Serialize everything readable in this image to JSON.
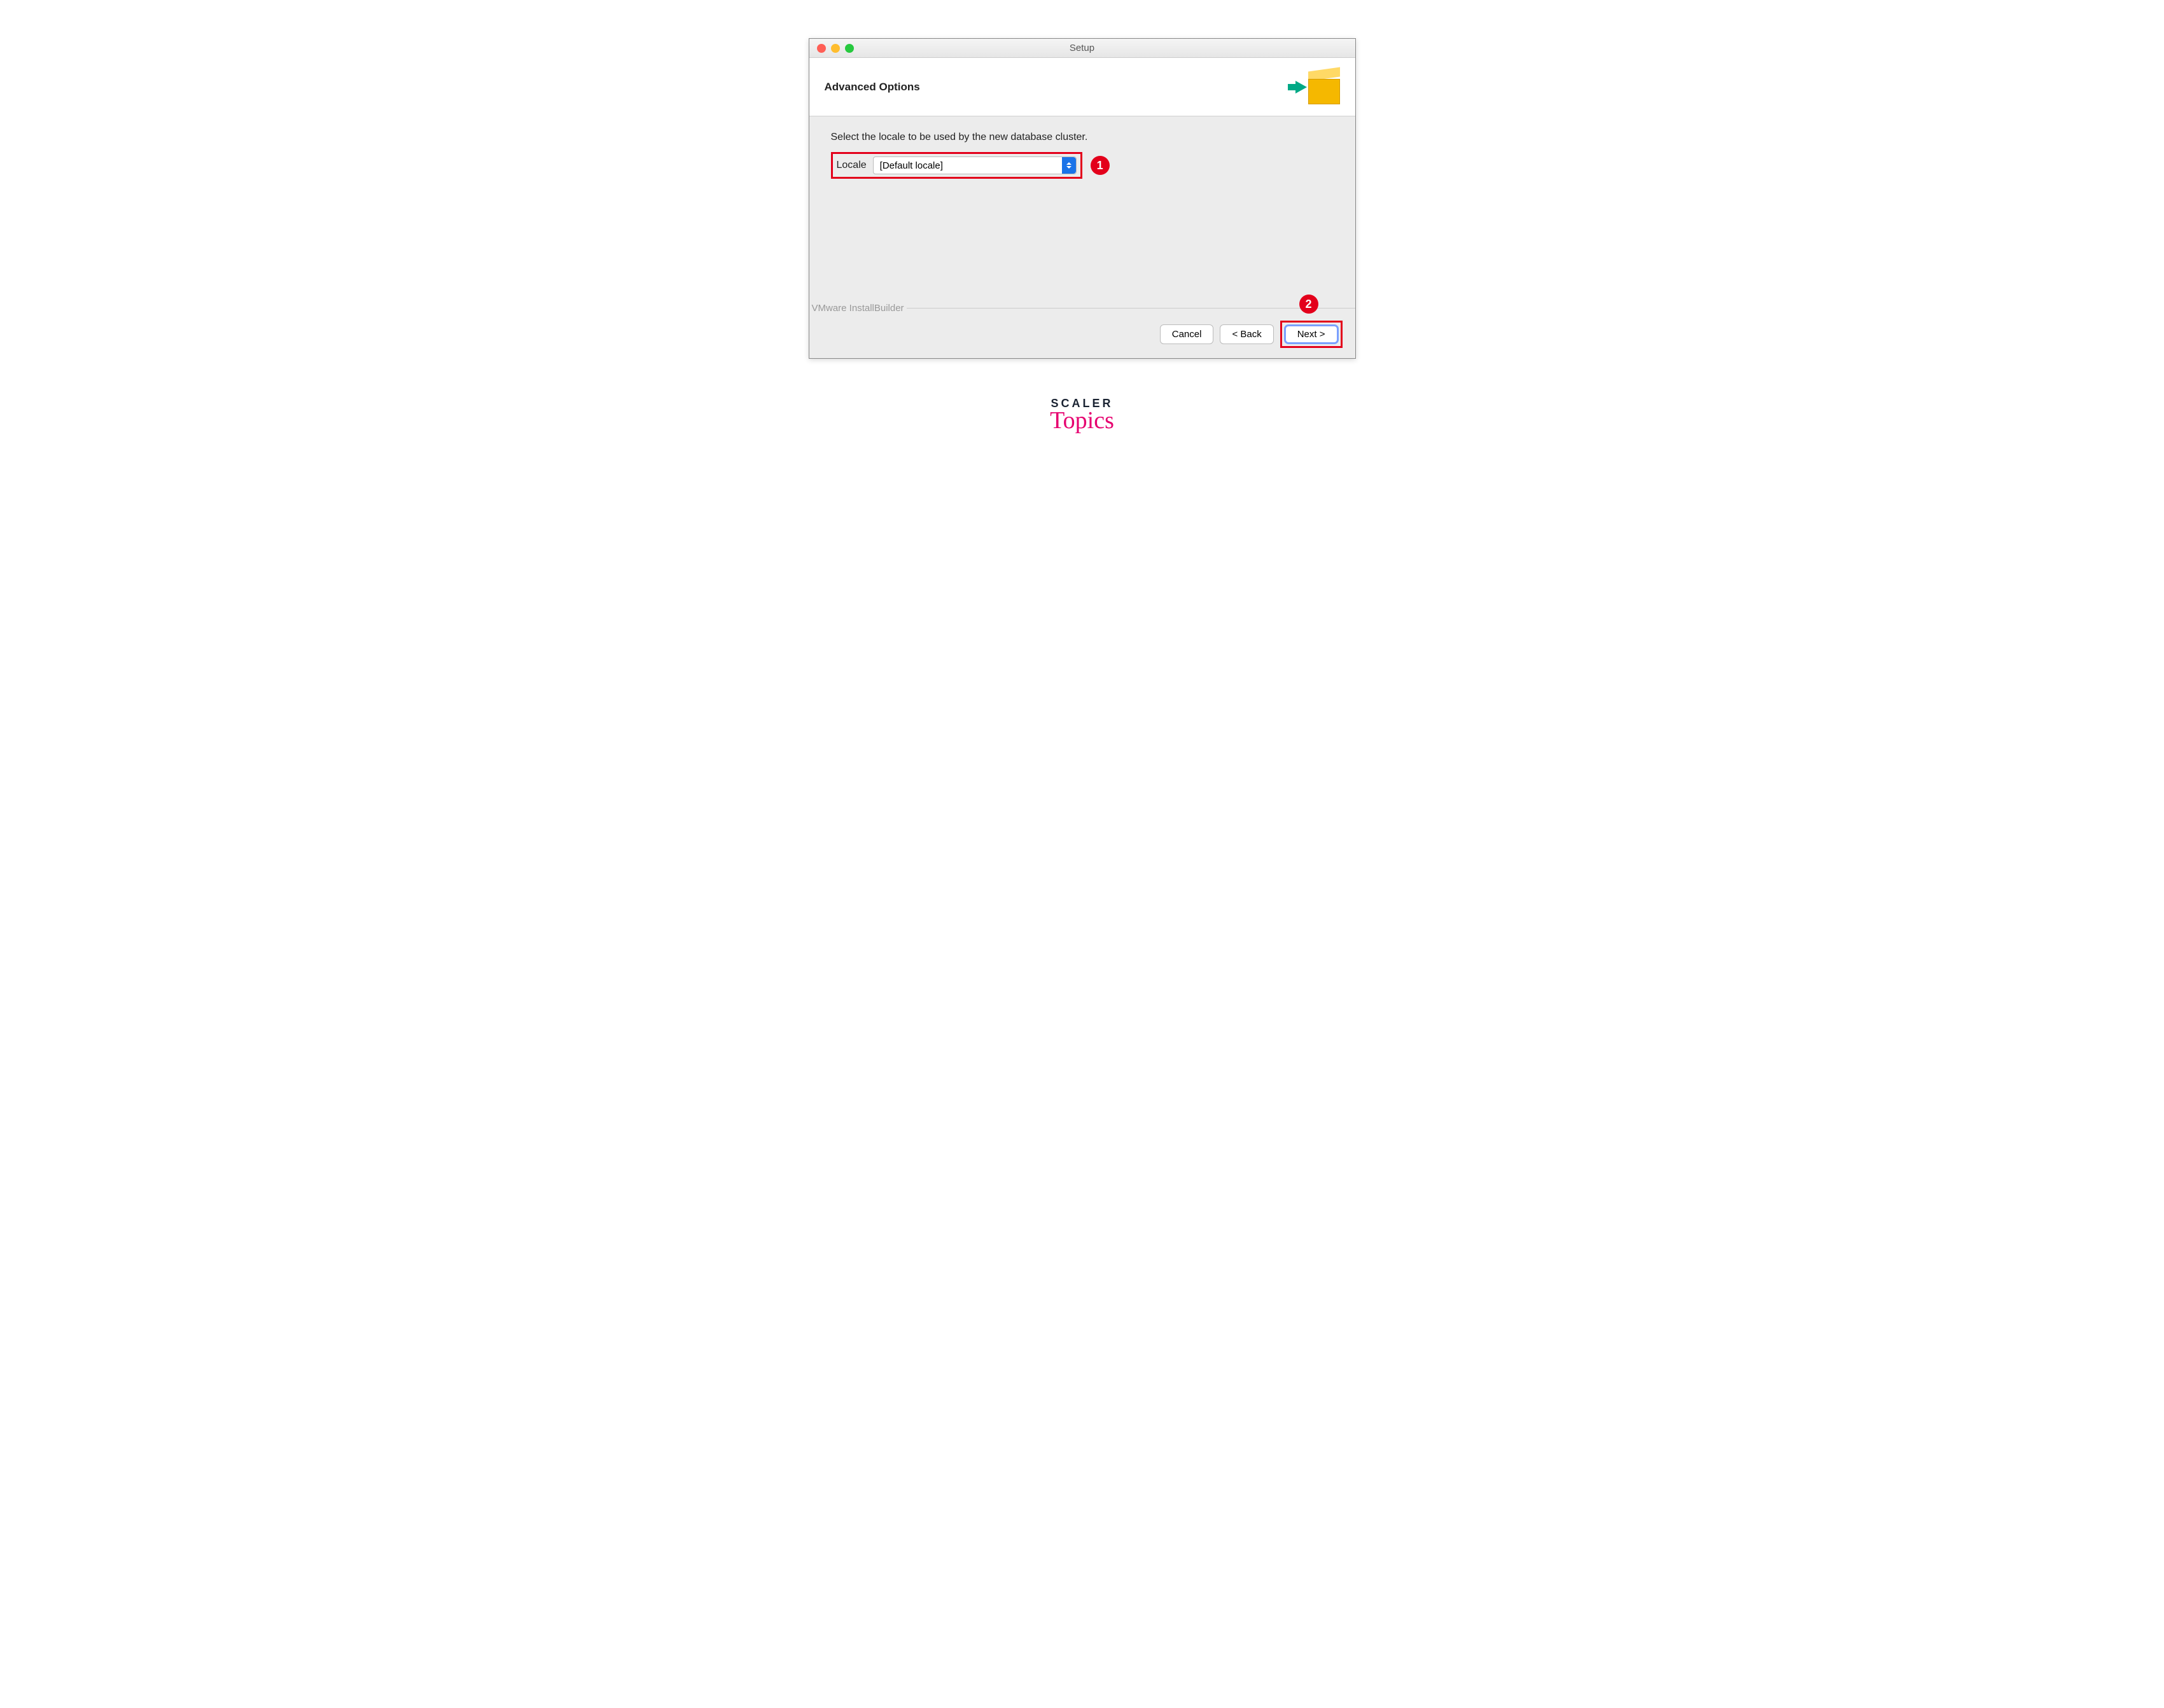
{
  "window": {
    "title": "Setup"
  },
  "header": {
    "title": "Advanced Options"
  },
  "content": {
    "instruction": "Select the locale to be used by the new database cluster.",
    "locale_label": "Locale",
    "locale_value": "[Default locale]"
  },
  "footer": {
    "brand": "VMware InstallBuilder",
    "cancel": "Cancel",
    "back": "< Back",
    "next": "Next >"
  },
  "callouts": {
    "one": "1",
    "two": "2"
  },
  "watermark": {
    "line1": "SCALER",
    "line2": "Topics"
  }
}
